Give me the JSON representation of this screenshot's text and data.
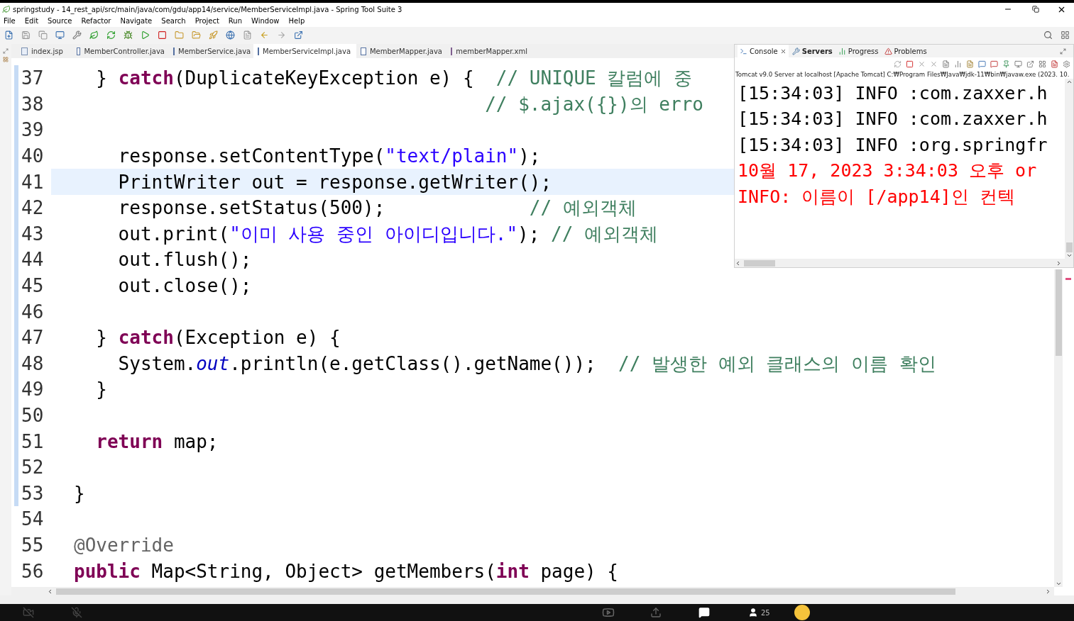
{
  "window": {
    "title": "springstudy - 14_rest_api/src/main/java/com/gdu/app14/service/MemberServiceImpl.java - Spring Tool Suite 3"
  },
  "menu": [
    "File",
    "Edit",
    "Source",
    "Refactor",
    "Navigate",
    "Search",
    "Project",
    "Run",
    "Window",
    "Help"
  ],
  "editor_tabs": [
    {
      "label": "index.jsp",
      "kind": "jsp",
      "selected": false
    },
    {
      "label": "MemberController.java",
      "kind": "java",
      "selected": false
    },
    {
      "label": "MemberService.java",
      "kind": "java",
      "selected": false
    },
    {
      "label": "MemberServiceImpl.java",
      "kind": "java",
      "selected": true
    },
    {
      "label": "MemberMapper.java",
      "kind": "java",
      "selected": false
    },
    {
      "label": "memberMapper.xml",
      "kind": "xml",
      "selected": false
    }
  ],
  "code_lines": [
    {
      "number": "37",
      "changed": true,
      "current": false,
      "tokens": [
        {
          "text": "  } ",
          "kind": "plain"
        },
        {
          "text": "catch",
          "kind": "keyword"
        },
        {
          "text": "(DuplicateKeyException e) {  ",
          "kind": "plain"
        },
        {
          "text": "// UNIQUE 칼럼에 중",
          "kind": "comment"
        }
      ]
    },
    {
      "number": "38",
      "changed": true,
      "current": false,
      "tokens": [
        {
          "text": "                                     // $.ajax({})의 erro",
          "kind": "comment"
        }
      ]
    },
    {
      "number": "39",
      "changed": true,
      "current": false
    },
    {
      "number": "40",
      "changed": true,
      "current": false,
      "tokens": [
        {
          "text": "    response.setContentType(",
          "kind": "plain"
        },
        {
          "text": "\"text/plain\"",
          "kind": "string"
        },
        {
          "text": ");",
          "kind": "plain"
        }
      ]
    },
    {
      "number": "41",
      "changed": true,
      "current": true,
      "tokens": [
        {
          "text": "    PrintWriter out = response.getWriter();",
          "kind": "plain"
        }
      ]
    },
    {
      "number": "42",
      "changed": true,
      "current": false,
      "tokens": [
        {
          "text": "    response.setStatus(500);             ",
          "kind": "plain"
        },
        {
          "text": "// 예외객체",
          "kind": "comment"
        }
      ]
    },
    {
      "number": "43",
      "changed": true,
      "current": false,
      "tokens": [
        {
          "text": "    out.print(",
          "kind": "plain"
        },
        {
          "text": "\"이미 사용 중인 아이디입니다.\"",
          "kind": "string"
        },
        {
          "text": "); ",
          "kind": "plain"
        },
        {
          "text": "// 예외객체",
          "kind": "comment"
        }
      ]
    },
    {
      "number": "44",
      "changed": true,
      "current": false,
      "tokens": [
        {
          "text": "    out.flush();",
          "kind": "plain"
        }
      ]
    },
    {
      "number": "45",
      "changed": true,
      "current": false,
      "tokens": [
        {
          "text": "    out.close();",
          "kind": "plain"
        }
      ]
    },
    {
      "number": "46",
      "changed": true,
      "current": false
    },
    {
      "number": "47",
      "changed": true,
      "current": false,
      "tokens": [
        {
          "text": "  } ",
          "kind": "plain"
        },
        {
          "text": "catch",
          "kind": "keyword"
        },
        {
          "text": "(Exception e) {",
          "kind": "plain"
        }
      ]
    },
    {
      "number": "48",
      "changed": true,
      "current": false,
      "tokens": [
        {
          "text": "    System.",
          "kind": "plain"
        },
        {
          "text": "out",
          "kind": "field"
        },
        {
          "text": ".println(e.getClass().getName());  ",
          "kind": "plain"
        },
        {
          "text": "// 발생한 예외 클래스의 이름 확인",
          "kind": "comment"
        }
      ]
    },
    {
      "number": "49",
      "changed": true,
      "current": false,
      "tokens": [
        {
          "text": "  }",
          "kind": "plain"
        }
      ]
    },
    {
      "number": "50",
      "changed": true,
      "current": false
    },
    {
      "number": "51",
      "changed": true,
      "current": false,
      "tokens": [
        {
          "text": "  return",
          "kind": "keyword"
        },
        {
          "text": " map;",
          "kind": "plain"
        }
      ]
    },
    {
      "number": "52",
      "changed": true,
      "current": false
    },
    {
      "number": "53",
      "changed": true,
      "current": false,
      "tokens": [
        {
          "text": "}",
          "kind": "plain"
        }
      ]
    },
    {
      "number": "54",
      "changed": false,
      "current": false
    },
    {
      "number": "55",
      "changed": false,
      "current": false,
      "tokens": [
        {
          "text": "@Override",
          "kind": "annotation"
        }
      ]
    },
    {
      "number": "56",
      "changed": false,
      "current": false,
      "tokens": [
        {
          "text": "public",
          "kind": "keyword"
        },
        {
          "text": " Map<String, Object> getMembers(",
          "kind": "plain"
        },
        {
          "text": "int",
          "kind": "keyword"
        },
        {
          "text": " page) {",
          "kind": "plain"
        }
      ]
    }
  ],
  "console": {
    "tabs": [
      {
        "label": "Console",
        "selected": true,
        "bold": false
      },
      {
        "label": "Servers",
        "selected": false,
        "bold": true
      },
      {
        "label": "Progress",
        "selected": false,
        "bold": false
      },
      {
        "label": "Problems",
        "selected": false,
        "bold": false
      }
    ],
    "process_label": "Tomcat v9.0 Server at localhost [Apache Tomcat] C:₩Program Files₩Java₩jdk-11₩bin₩javaw.exe  (2023. 10.",
    "lines": [
      {
        "text": "[15:34:03] INFO :com.zaxxer.h",
        "color": "#000000"
      },
      {
        "text": "[15:34:03] INFO :com.zaxxer.h",
        "color": "#000000"
      },
      {
        "text": "[15:34:03] INFO :org.springfr",
        "color": "#000000"
      },
      {
        "text": "10월 17, 2023 3:34:03 오후 or",
        "color": "#ff0000"
      },
      {
        "text": "INFO: 이름이 [/app14]인 컨텍",
        "color": "#ff0000"
      }
    ]
  },
  "meeting_bar": {
    "participant_count": "25"
  }
}
